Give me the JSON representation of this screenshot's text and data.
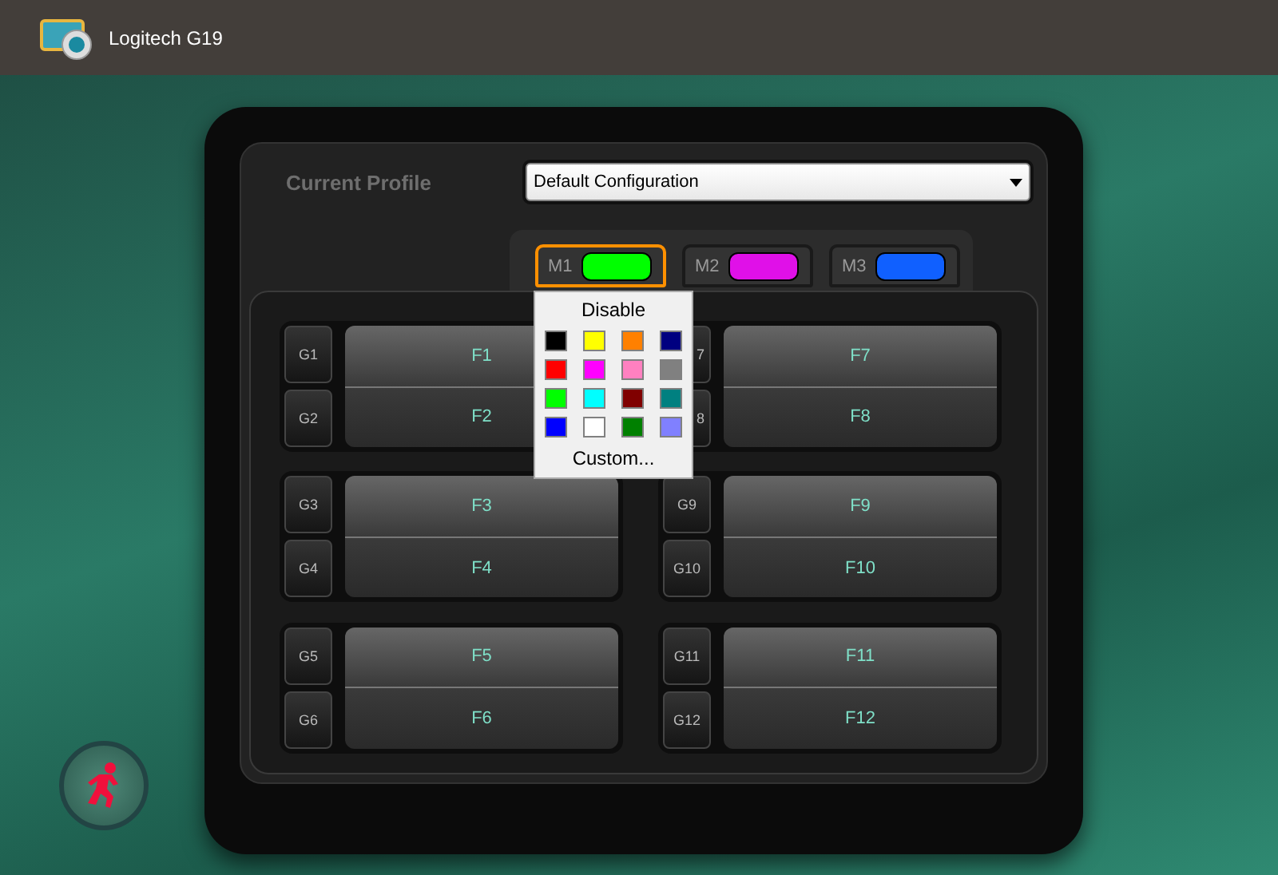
{
  "window": {
    "title": "Logitech G19"
  },
  "profile": {
    "label": "Current Profile",
    "value": "Default Configuration"
  },
  "modes": [
    {
      "label": "M1",
      "color": "#00ff00",
      "selected": true
    },
    {
      "label": "M2",
      "color": "#e010e8",
      "selected": false
    },
    {
      "label": "M3",
      "color": "#1060ff",
      "selected": false
    }
  ],
  "color_menu": {
    "disable": "Disable",
    "custom": "Custom...",
    "swatches": [
      {
        "color": "#000000"
      },
      {
        "color": "#ffff00"
      },
      {
        "color": "#ff8000"
      },
      {
        "color": "#000080"
      },
      {
        "color": "#ff0000"
      },
      {
        "color": "#ff00ff"
      },
      {
        "color": "#ff80c0"
      },
      {
        "color": "#808080"
      },
      {
        "color": "#00ff00"
      },
      {
        "color": "#00ffff"
      },
      {
        "color": "#800000"
      },
      {
        "color": "#008080"
      },
      {
        "color": "#0000ff"
      },
      {
        "color": "#ffffff"
      },
      {
        "color": "#008000"
      },
      {
        "color": "#8080ff"
      }
    ]
  },
  "key_groups": [
    {
      "g_keys": [
        {
          "label": "G1",
          "covered": false
        },
        {
          "label": "G2",
          "covered": false
        }
      ],
      "f_keys": [
        "F1",
        "F2"
      ]
    },
    {
      "g_keys": [
        {
          "label": "7",
          "covered": true
        },
        {
          "label": "8",
          "covered": true
        }
      ],
      "f_keys": [
        "F7",
        "F8"
      ]
    },
    {
      "g_keys": [
        {
          "label": "G3",
          "covered": false
        },
        {
          "label": "G4",
          "covered": false
        }
      ],
      "f_keys": [
        "F3",
        "F4"
      ]
    },
    {
      "g_keys": [
        {
          "label": "G9",
          "covered": false
        },
        {
          "label": "G10",
          "covered": false
        }
      ],
      "f_keys": [
        "F9",
        "F10"
      ]
    },
    {
      "g_keys": [
        {
          "label": "G5",
          "covered": false
        },
        {
          "label": "G6",
          "covered": false
        }
      ],
      "f_keys": [
        "F5",
        "F6"
      ]
    },
    {
      "g_keys": [
        {
          "label": "G11",
          "covered": false
        },
        {
          "label": "G12",
          "covered": false
        }
      ],
      "f_keys": [
        "F11",
        "F12"
      ]
    }
  ]
}
